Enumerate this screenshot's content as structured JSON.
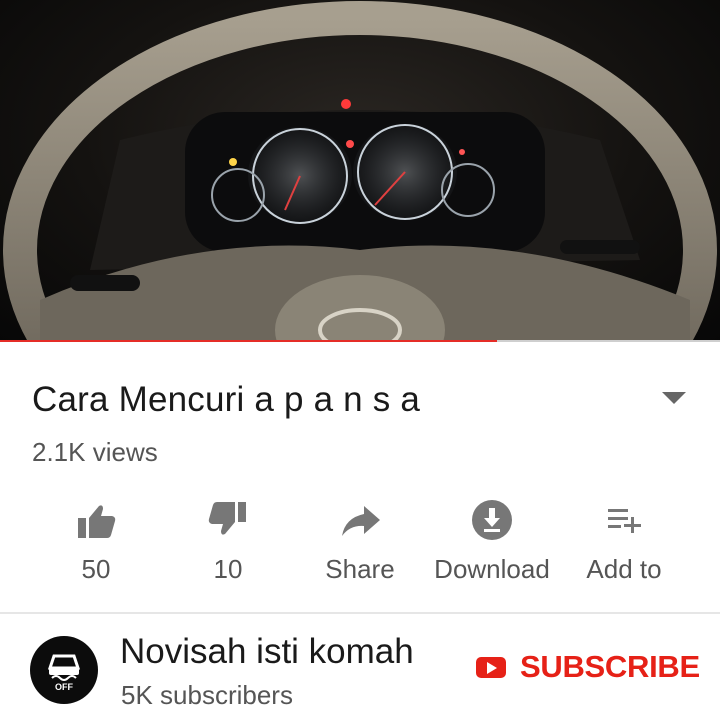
{
  "video": {
    "progress_fraction": 0.69,
    "progress_color": "#e52d27"
  },
  "info": {
    "title": "Cara Mencuri a p a n s a",
    "views": "2.1K views"
  },
  "actions": [
    {
      "icon": "thumbs-up-icon",
      "label": "50"
    },
    {
      "icon": "thumbs-down-icon",
      "label": "10"
    },
    {
      "icon": "share-icon",
      "label": "Share"
    },
    {
      "icon": "download-icon",
      "label": "Download"
    },
    {
      "icon": "add-to-playlist-icon",
      "label": "Add to"
    }
  ],
  "channel": {
    "name": "Novisah isti komah",
    "subscribers": "5K subscribers",
    "avatar_icon": "traction-control-off-icon",
    "avatar_text": "OFF"
  },
  "subscribe": {
    "label": "SUBSCRIBE",
    "color": "#e62117"
  }
}
